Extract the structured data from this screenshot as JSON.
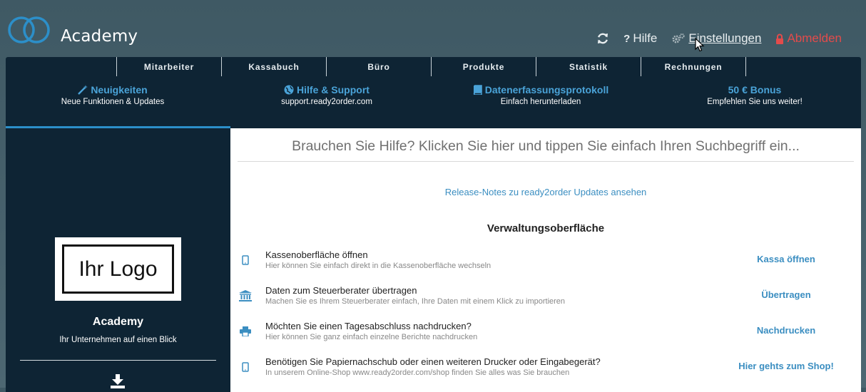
{
  "app": {
    "title": "Academy",
    "brand_color": "#2c8fc9"
  },
  "topnav": {
    "refresh_icon": "refresh-icon",
    "help_label": "Hilfe",
    "settings_label": "Einstellungen",
    "logout_label": "Abmelden",
    "logout_color": "#e34b4b"
  },
  "tabs": [
    {
      "label": "Mitarbeiter"
    },
    {
      "label": "Kassabuch"
    },
    {
      "label": "Büro"
    },
    {
      "label": "Produkte"
    },
    {
      "label": "Statistik"
    },
    {
      "label": "Rechnungen"
    }
  ],
  "promos": [
    {
      "title": "Neuigkeiten",
      "subtitle": "Neue Funktionen & Updates",
      "icon": "magic-wand-icon"
    },
    {
      "title": "Hilfe & Support",
      "subtitle": "support.ready2order.com",
      "icon": "globe-icon"
    },
    {
      "title": "Datenerfassungsprotokoll",
      "subtitle": "Einfach herunterladen",
      "icon": "book-icon"
    },
    {
      "title": "50 € Bonus",
      "subtitle": "Empfehlen Sie uns weiter!",
      "icon": ""
    }
  ],
  "sidebar": {
    "logo_text": "Ihr Logo",
    "company_name": "Academy",
    "tagline": "Ihr Unternehmen auf einen Blick",
    "download_icon": "download-icon"
  },
  "main": {
    "search_placeholder": "Brauchen Sie Hilfe? Klicken Sie hier und tippen Sie einfach Ihren Suchbegriff ein...",
    "release_notes_link": "Release-Notes zu ready2order Updates ansehen",
    "section_title": "Verwaltungsoberfläche",
    "rows": [
      {
        "icon": "tablet-icon",
        "title": "Kassenoberfläche öffnen",
        "subtitle": "Hier können Sie einfach direkt in die Kassenoberfläche wechseln",
        "action": "Kassa öffnen"
      },
      {
        "icon": "bank-icon",
        "title": "Daten zum Steuerberater übertragen",
        "subtitle": "Machen Sie es Ihrem Steuerberater einfach, Ihre Daten mit einem Klick zu importieren",
        "action": "Übertragen"
      },
      {
        "icon": "printer-icon",
        "title": "Möchten Sie einen Tagesabschluss nachdrucken?",
        "subtitle": "Hier können Sie ganz einfach einzelne Berichte nachdrucken",
        "action": "Nachdrucken"
      },
      {
        "icon": "tablet-icon",
        "title": "Benötigen Sie Papiernachschub oder einen weiteren Drucker oder Eingabegerät?",
        "subtitle": "In unserem Online-Shop www.ready2order.com/shop finden Sie alles was Sie brauchen",
        "action": "Hier gehts zum Shop!"
      }
    ]
  }
}
